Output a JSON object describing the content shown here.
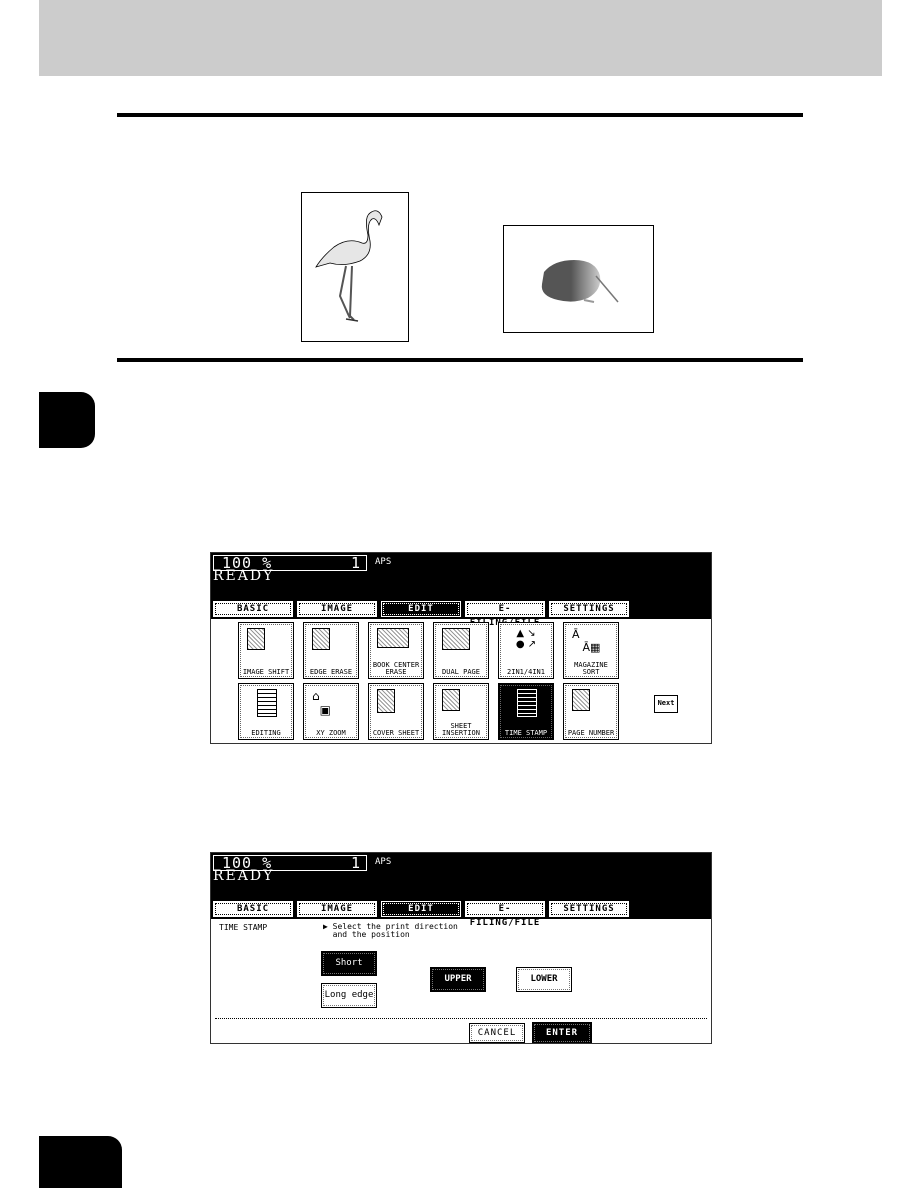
{
  "illustrations": {
    "left": {
      "subject": "flamingo",
      "orientation": "portrait"
    },
    "right": {
      "subject": "kiwi",
      "orientation": "landscape"
    }
  },
  "panel1": {
    "zoom": "100 %",
    "copies": "1",
    "paper": "APS",
    "status": "READY",
    "tabs": [
      {
        "label": "BASIC",
        "active": false
      },
      {
        "label": "IMAGE",
        "active": false
      },
      {
        "label": "EDIT",
        "active": true
      },
      {
        "label": "E-FILING/FILE",
        "active": false
      },
      {
        "label": "SETTINGS",
        "active": false
      }
    ],
    "functions": [
      {
        "label": "IMAGE SHIFT",
        "icon": "image-shift-icon",
        "active": false
      },
      {
        "label": "EDGE ERASE",
        "icon": "edge-erase-icon",
        "active": false
      },
      {
        "label": "BOOK CENTER ERASE",
        "icon": "book-center-erase-icon",
        "active": false
      },
      {
        "label": "DUAL PAGE",
        "icon": "dual-page-icon",
        "active": false
      },
      {
        "label": "2IN1/4IN1",
        "icon": "2in1-4in1-icon",
        "active": false
      },
      {
        "label": "MAGAZINE SORT",
        "icon": "magazine-sort-icon",
        "active": false
      },
      {
        "label": "EDITING",
        "icon": "editing-icon",
        "active": false
      },
      {
        "label": "XY ZOOM",
        "icon": "xy-zoom-icon",
        "active": false
      },
      {
        "label": "COVER SHEET",
        "icon": "cover-sheet-icon",
        "active": false
      },
      {
        "label": "SHEET INSERTION",
        "icon": "sheet-insertion-icon",
        "active": false
      },
      {
        "label": "TIME STAMP",
        "icon": "time-stamp-icon",
        "active": true
      },
      {
        "label": "PAGE NUMBER",
        "icon": "page-number-icon",
        "active": false
      }
    ],
    "next_label": "Next"
  },
  "panel2": {
    "zoom": "100 %",
    "copies": "1",
    "paper": "APS",
    "status": "READY",
    "tabs": [
      {
        "label": "BASIC"
      },
      {
        "label": "IMAGE"
      },
      {
        "label": "EDIT"
      },
      {
        "label": "E-FILING/FILE"
      },
      {
        "label": "SETTINGS"
      }
    ],
    "title": "TIME STAMP",
    "instruction": "▶ Select the print direction\n  and the position",
    "direction": {
      "short": "Short edge",
      "long": "Long edge",
      "selected": "Short edge"
    },
    "position": {
      "upper": "UPPER",
      "lower": "LOWER",
      "selected": "UPPER"
    },
    "cancel_label": "CANCEL",
    "enter_label": "ENTER"
  }
}
